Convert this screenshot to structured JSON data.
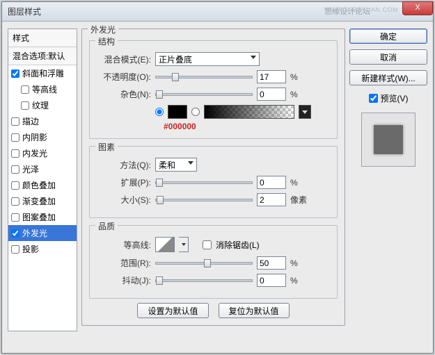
{
  "window": {
    "title": "图层样式",
    "forum": "思缘设计论坛",
    "url": "WWW.MISSYUAN.COM",
    "close": "X"
  },
  "sidebar": {
    "header": "样式",
    "subheader": "混合选项:默认",
    "items": [
      {
        "label": "斜面和浮雕",
        "checked": true,
        "indent": false
      },
      {
        "label": "等高线",
        "checked": false,
        "indent": true
      },
      {
        "label": "纹理",
        "checked": false,
        "indent": true
      },
      {
        "label": "描边",
        "checked": false,
        "indent": false
      },
      {
        "label": "内阴影",
        "checked": false,
        "indent": false
      },
      {
        "label": "内发光",
        "checked": false,
        "indent": false
      },
      {
        "label": "光泽",
        "checked": false,
        "indent": false
      },
      {
        "label": "颜色叠加",
        "checked": false,
        "indent": false
      },
      {
        "label": "渐变叠加",
        "checked": false,
        "indent": false
      },
      {
        "label": "图案叠加",
        "checked": false,
        "indent": false
      },
      {
        "label": "外发光",
        "checked": true,
        "indent": false,
        "selected": true
      },
      {
        "label": "投影",
        "checked": false,
        "indent": false
      }
    ]
  },
  "panel": {
    "title": "外发光",
    "structure": {
      "legend": "结构",
      "blend_label": "混合模式(E):",
      "blend_value": "正片叠底",
      "opacity_label": "不透明度(O):",
      "opacity_value": "17",
      "opacity_unit": "%",
      "noise_label": "杂色(N):",
      "noise_value": "0",
      "noise_unit": "%",
      "hex": "#000000"
    },
    "elements": {
      "legend": "图素",
      "technique_label": "方法(Q):",
      "technique_value": "柔和",
      "spread_label": "扩展(P):",
      "spread_value": "0",
      "spread_unit": "%",
      "size_label": "大小(S):",
      "size_value": "2",
      "size_unit": "像素"
    },
    "quality": {
      "legend": "品质",
      "contour_label": "等高线:",
      "antialias_label": "消除锯齿(L)",
      "range_label": "范围(R):",
      "range_value": "50",
      "range_unit": "%",
      "jitter_label": "抖动(J):",
      "jitter_value": "0",
      "jitter_unit": "%"
    },
    "defaults": {
      "set": "设置为默认值",
      "reset": "复位为默认值"
    }
  },
  "buttons": {
    "ok": "确定",
    "cancel": "取消",
    "new_style": "新建样式(W)...",
    "preview": "预览(V)"
  }
}
